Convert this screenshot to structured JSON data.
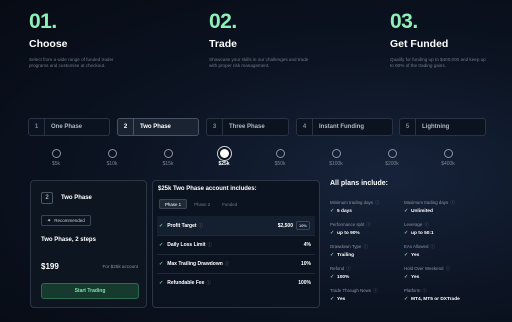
{
  "steps": [
    {
      "num": "01.",
      "title": "Choose",
      "desc": "Select from a wide range of funded trader programs and customise at checkout."
    },
    {
      "num": "02.",
      "title": "Trade",
      "desc": "Showcase your skills in our challenges and trade with proper risk management."
    },
    {
      "num": "03.",
      "title": "Get Funded",
      "desc": "Qualify for funding up to $400,000 and keep up to 90% of the trading gains."
    }
  ],
  "tabs": [
    {
      "num": "1",
      "label": "One Phase"
    },
    {
      "num": "2",
      "label": "Two Phase"
    },
    {
      "num": "3",
      "label": "Three Phase"
    },
    {
      "num": "4",
      "label": "Instant Funding"
    },
    {
      "num": "5",
      "label": "Lightning"
    }
  ],
  "active_tab": 1,
  "account_sizes": [
    "$5k",
    "$10k",
    "$15k",
    "$25k",
    "$50k",
    "$100k",
    "$200k",
    "$400k"
  ],
  "selected_size": 3,
  "card": {
    "num": "2",
    "name": "Two Phase",
    "badge": "Recommended",
    "subtitle": "Two Phase, 2 steps",
    "price": "$199",
    "for_text": "For $25k account",
    "button": "Start Trading"
  },
  "details": {
    "title": "$25k Two Phase account includes:",
    "tabs": [
      "Phase 1",
      "Phase 2",
      "Funded"
    ],
    "rules": [
      {
        "label": "Profit Target",
        "value": "$2,500",
        "pct": "10%"
      },
      {
        "label": "Daily Loss Limit",
        "value": "4%"
      },
      {
        "label": "Max Trailing Drawdown",
        "value": "10%"
      },
      {
        "label": "Refundable Fee",
        "value": "100%"
      }
    ]
  },
  "plans": {
    "title": "All plans include:",
    "items": [
      {
        "label": "Minimum trading days",
        "value": "5 days"
      },
      {
        "label": "Maximum trading days",
        "value": "Unlimited"
      },
      {
        "label": "Performance split",
        "value": "up to 90%"
      },
      {
        "label": "Leverage",
        "value": "up to 50:1"
      },
      {
        "label": "Drawdown Type",
        "value": "Trailing"
      },
      {
        "label": "EAs Allowed",
        "value": "Yes"
      },
      {
        "label": "Refund",
        "value": "100%"
      },
      {
        "label": "Hold Over Weekend",
        "value": "Yes"
      },
      {
        "label": "Trade Through News",
        "value": "Yes"
      },
      {
        "label": "Platform",
        "value": "MT4, MT5 or DXTrade"
      }
    ]
  },
  "colors": {
    "accent": "#8ef0b8",
    "check": "#6fd39a",
    "background": "#0b1220"
  }
}
